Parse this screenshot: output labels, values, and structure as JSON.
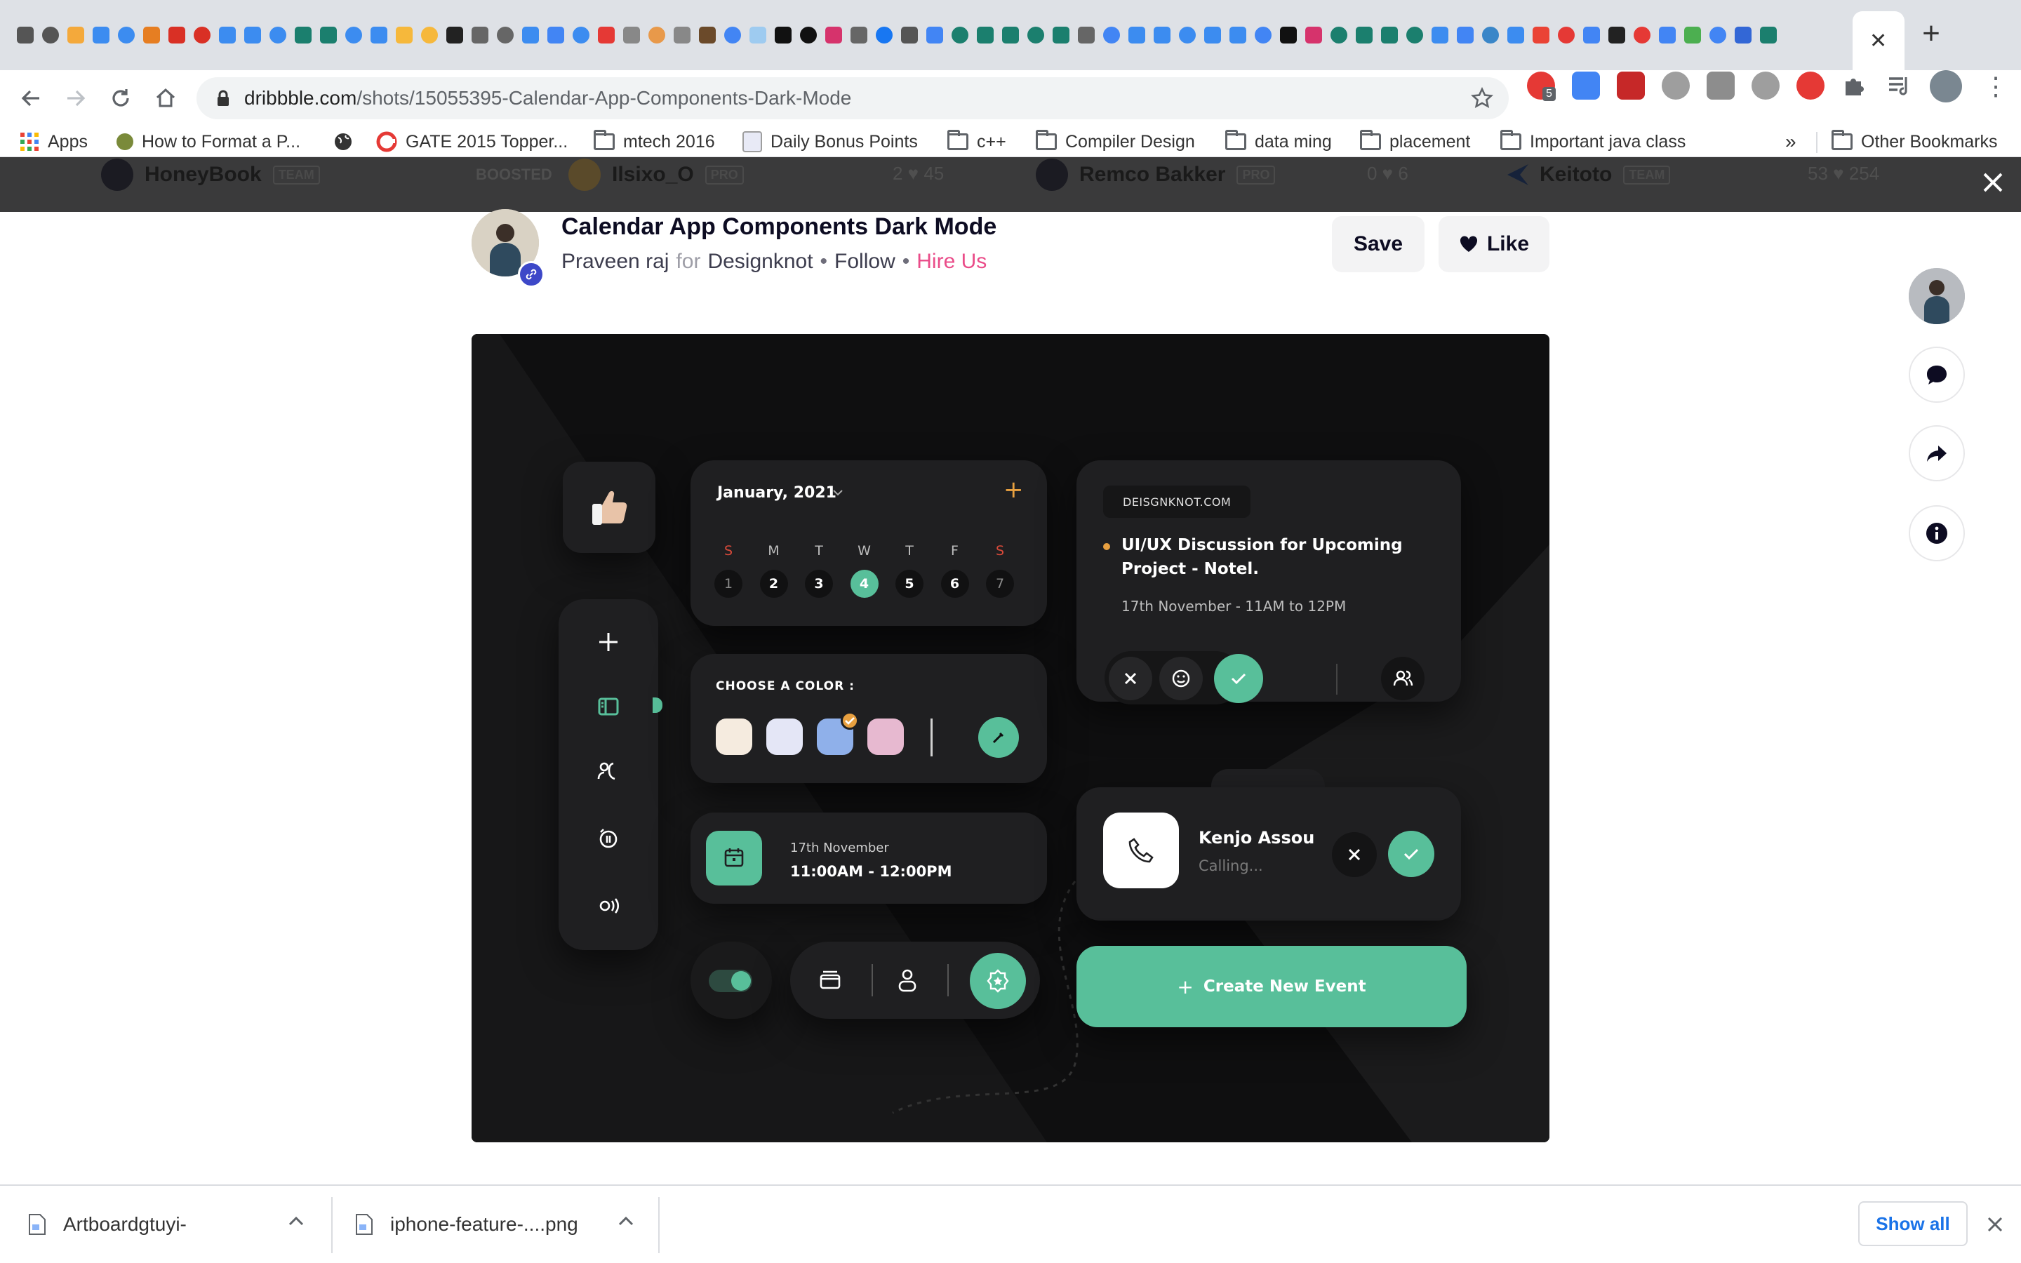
{
  "browser": {
    "tab_favicon_colors": [
      "#555555",
      "#555555",
      "#f4a93b",
      "#3c8cf0",
      "#3c8cf0",
      "#e67e22",
      "#d93025",
      "#d93025",
      "#3c8cf0",
      "#3c8cf0",
      "#3c8cf0",
      "#1b7f6e",
      "#1b7f6e",
      "#3c8cf0",
      "#3c8cf0",
      "#f6b83b",
      "#f6b83b",
      "#222222",
      "#666666",
      "#666666",
      "#3c8cf0",
      "#4285f4",
      "#3c8cf0",
      "#e53935",
      "#888888",
      "#e8994a",
      "#888888",
      "#6b4a2a",
      "#4285f4",
      "#9ecbf0",
      "#111111",
      "#111111",
      "#d6336c",
      "#666666",
      "#1877f2",
      "#555555",
      "#4285f4",
      "#1b7f6e",
      "#1b7f6e",
      "#1b7f6e",
      "#1b7f6e",
      "#1b7f6e",
      "#666666",
      "#4285f4",
      "#3c8cf0",
      "#3c8cf0",
      "#3c8cf0",
      "#3c8cf0",
      "#3c8cf0",
      "#4285f4",
      "#111111",
      "#d6336c",
      "#1b7f6e",
      "#1b7f6e",
      "#1b7f6e",
      "#1b7f6e",
      "#3c8cf0",
      "#4285f4",
      "#3a86c8",
      "#3c8cf0",
      "#ea4335",
      "#e53935",
      "#4285f4",
      "#222222",
      "#e53935",
      "#4285f4",
      "#4caf50",
      "#4285f4",
      "#3367d6",
      "#1b7f6e"
    ],
    "active_tab_close": "✕",
    "new_tab": "+",
    "url_domain": "dribbble.com",
    "url_path": "/shots/15055395-Calendar-App-Components-Dark-Mode",
    "extension_badge": "5",
    "bookmarks": [
      {
        "label": "Apps",
        "icon": "apps-grid-icon"
      },
      {
        "label": "How to Format a P...",
        "icon": "site-icon"
      },
      {
        "label": "",
        "icon": "globe-icon"
      },
      {
        "label": "GATE 2015 Topper...",
        "icon": "site-icon"
      },
      {
        "label": "mtech 2016",
        "icon": "folder-icon"
      },
      {
        "label": "Daily Bonus Points",
        "icon": "site-icon"
      },
      {
        "label": "c++",
        "icon": "folder-icon"
      },
      {
        "label": "Compiler Design",
        "icon": "folder-icon"
      },
      {
        "label": "data ming",
        "icon": "folder-icon"
      },
      {
        "label": "placement",
        "icon": "folder-icon"
      },
      {
        "label": "Important java class",
        "icon": "folder-icon"
      }
    ],
    "bookmarks_overflow": "»",
    "other_bookmarks": "Other Bookmarks"
  },
  "background_feed": [
    {
      "name": "HoneyBook",
      "badge": "TEAM",
      "boosted": "BOOSTED"
    },
    {
      "name": "Ilsixo_O",
      "badge": "PRO",
      "stats": "2  ♥ 45"
    },
    {
      "name": "Remco Bakker",
      "badge": "PRO",
      "stats": "0  ♥ 6"
    },
    {
      "name": "Keitoto",
      "badge": "TEAM",
      "stats": "53  ♥ 254"
    }
  ],
  "shot": {
    "title": "Calendar App Components Dark Mode",
    "author": "Praveen raj",
    "for": "for",
    "team": "Designknot",
    "bullet": "•",
    "follow": "Follow",
    "hire": "Hire Us",
    "save": "Save",
    "like": "Like"
  },
  "design": {
    "calendar": {
      "month": "January, 2021",
      "add": "+",
      "weekdays": [
        "S",
        "M",
        "T",
        "W",
        "T",
        "F",
        "S"
      ],
      "days": [
        "1",
        "2",
        "3",
        "4",
        "5",
        "6",
        "7"
      ],
      "selected_day": "4"
    },
    "color_picker": {
      "label": "CHOOSE A COLOR :",
      "swatches": [
        "#f5ebdf",
        "#e4e6f6",
        "#8fb0ea",
        "#e7b9d0"
      ],
      "selected_index": 2,
      "accent": "#58bf9a"
    },
    "event_time": {
      "date": "17th November",
      "time": "11:00AM - 12:00PM"
    },
    "event_card": {
      "tag": "DEISGNKNOT.COM",
      "title_line1": "UI/UX Discussion for Upcoming",
      "title_line2": "Project - Notel.",
      "when": "17th November - 11AM to 12PM"
    },
    "call": {
      "name": "Kenjo Assou",
      "status": "Calling..."
    },
    "create_button": "Create New Event",
    "create_plus": "+"
  },
  "downloads": {
    "items": [
      "Artboardgtuyi-",
      "iphone-feature-....png"
    ],
    "show_all": "Show all"
  }
}
